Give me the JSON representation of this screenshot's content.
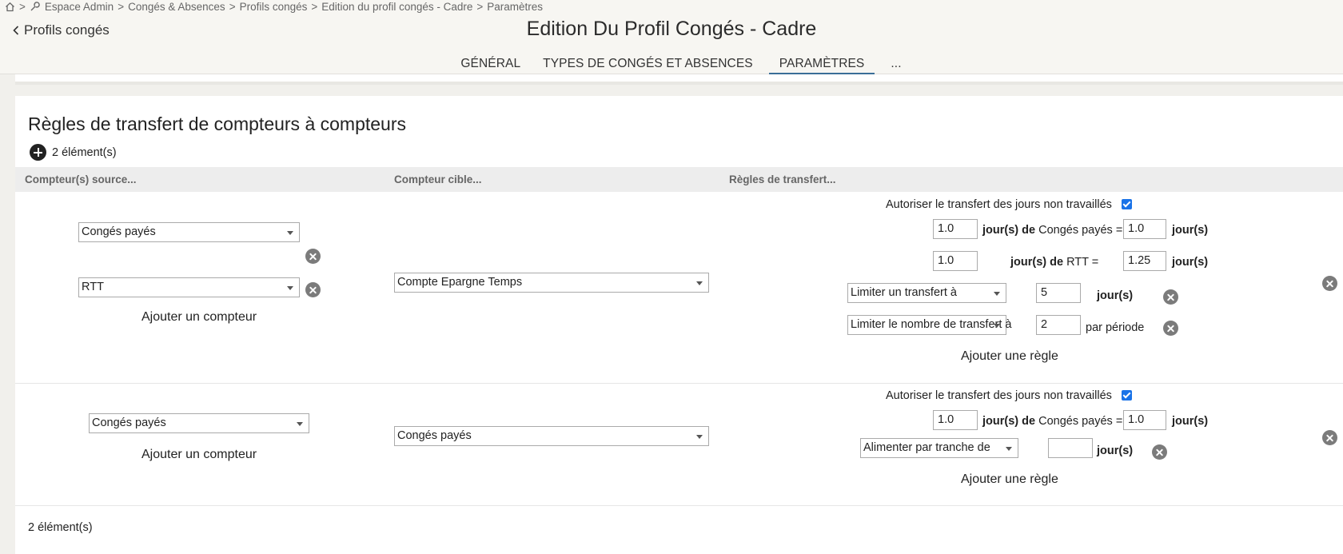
{
  "breadcrumb": {
    "sep": ">",
    "items": [
      "Espace Admin",
      "Congés & Absences",
      "Profils congés",
      "Edition du profil congés - Cadre",
      "Paramètres"
    ]
  },
  "header": {
    "back_label": "Profils congés",
    "title": "Edition Du Profil Congés - Cadre"
  },
  "tabs": [
    "GÉNÉRAL",
    "TYPES DE CONGÉS ET ABSENCES",
    "PARAMÈTRES",
    "..."
  ],
  "section": {
    "title": "Règles de transfert de compteurs à compteurs",
    "count_top": "2 élément(s)",
    "count_bottom": "2 élément(s)",
    "columns": [
      "Compteur(s) source...",
      "Compteur cible...",
      "Règles de transfert..."
    ],
    "add_counter_label": "Ajouter un compteur",
    "add_rule_label": "Ajouter une règle",
    "allow_label": "Autoriser le transfert des jours non travaillés",
    "days_unit": "jour(s)",
    "per_period": "par période",
    "rows": [
      {
        "sources": [
          "Congés payés",
          "RTT"
        ],
        "target": "Compte Epargne Temps",
        "allow_checked": true,
        "ratios": [
          {
            "from": "1.0",
            "label_prefix": "jour(s) de",
            "label_name": "Congés payés =",
            "to": "1.0"
          },
          {
            "from": "1.0",
            "label_prefix": "jour(s) de",
            "label_name": "RTT =",
            "to": "1.25"
          }
        ],
        "rules": [
          {
            "type": "Limiter un transfert à",
            "value": "5"
          },
          {
            "type": "Limiter le nombre de transfert à",
            "value": "2"
          }
        ]
      },
      {
        "sources": [
          "Congés payés"
        ],
        "target": "Congés payés",
        "allow_checked": true,
        "ratios": [
          {
            "from": "1.0",
            "label_prefix": "jour(s) de",
            "label_name": "Congés payés =",
            "to": "1.0"
          }
        ],
        "rules": [
          {
            "type": "Alimenter par tranche de",
            "value": ""
          }
        ]
      }
    ]
  }
}
